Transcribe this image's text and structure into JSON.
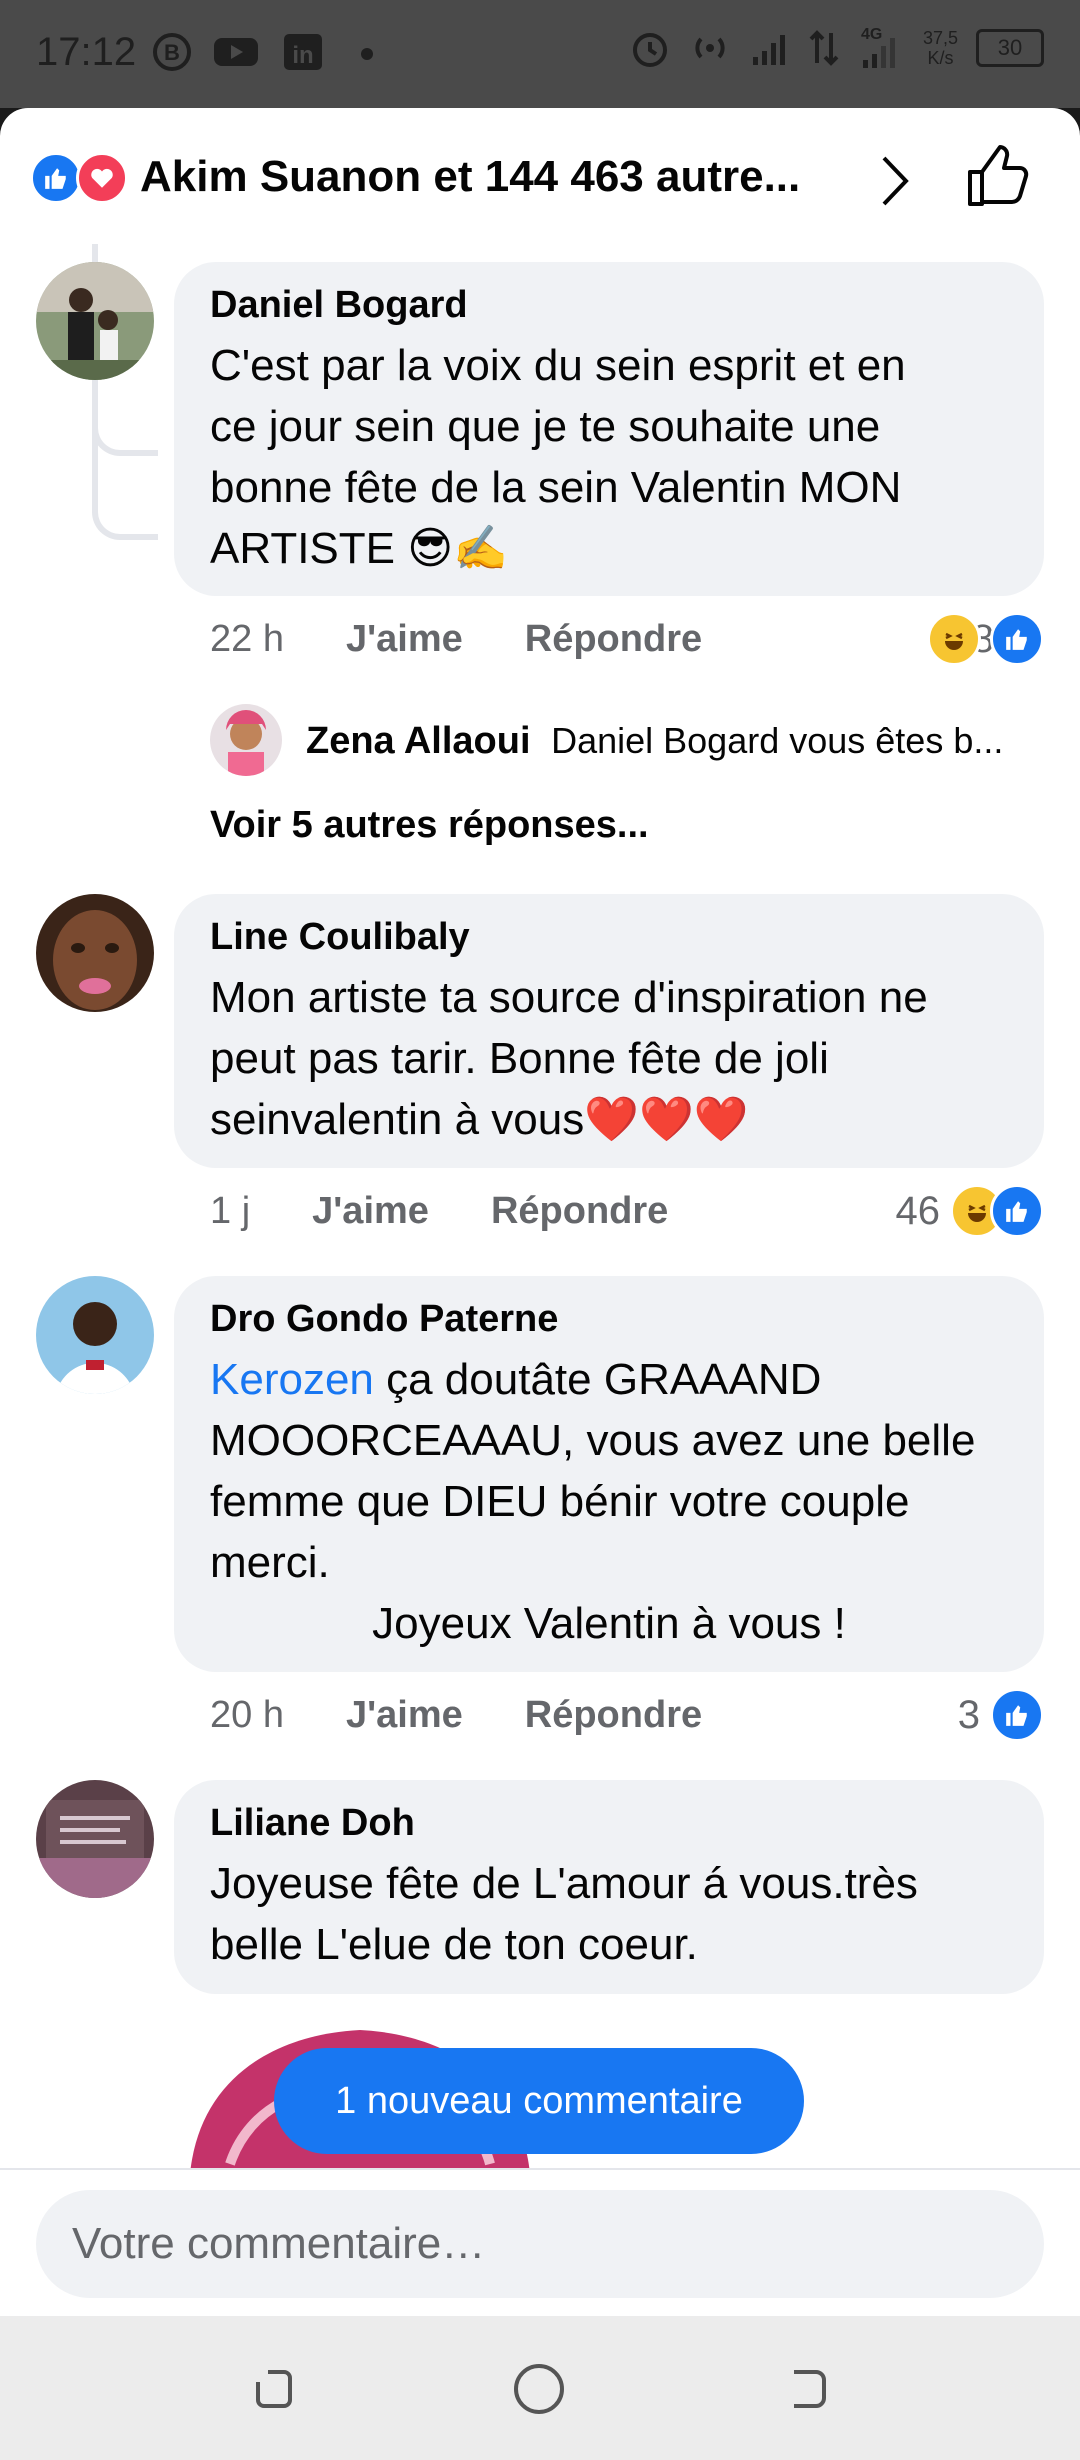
{
  "status": {
    "time": "17:12",
    "net_speed_value": "37,5",
    "net_speed_unit": "K/s",
    "battery": "30",
    "network": "4G"
  },
  "header": {
    "title": "Akim Suanon et 144 463 autre..."
  },
  "comments": [
    {
      "author": "Daniel Bogard",
      "lines": [
        "C'est par la voix du sein esprit et en",
        "ce jour sein que je te souhaite une",
        "bonne fête de la sein Valentin MON",
        "ARTISTE 😎✍️"
      ],
      "time": "22 h",
      "like": "J'aime",
      "reply": "Répondre",
      "reactions": "148",
      "sub_reply": {
        "author": "Zena Allaoui",
        "text": "Daniel Bogard  vous êtes b..."
      },
      "more": "Voir 5 autres réponses..."
    },
    {
      "author": "Line Coulibaly",
      "lines": [
        "Mon artiste ta source d'inspiration ne",
        "peut pas tarir. Bonne fête de joli",
        "seinvalentin à vous❤️❤️❤️"
      ],
      "time": "1 j",
      "like": "J'aime",
      "reply": "Répondre",
      "reactions": "46"
    },
    {
      "author": "Dro Gondo Paterne",
      "mention": "Kerozen",
      "first_line_rest": " ça doutâte GRAAAND",
      "lines": [
        "MOOORCEAAAU, vous avez une belle",
        "femme que DIEU bénir votre couple",
        "merci."
      ],
      "last_line": "Joyeux Valentin à vous !",
      "time": "20 h",
      "like": "J'aime",
      "reply": "Répondre",
      "reactions": "3"
    },
    {
      "author": "Liliane Doh",
      "lines": [
        "Joyeuse fête de L'amour á vous.très",
        "belle L'elue de ton coeur."
      ]
    }
  ],
  "new_comment_pill": "1 nouveau commentaire",
  "composer": {
    "placeholder": "Votre commentaire…"
  },
  "colors": {
    "accent": "#1877f2",
    "love": "#f33e58",
    "bubble": "#f0f2f5",
    "muted": "#65676b"
  }
}
